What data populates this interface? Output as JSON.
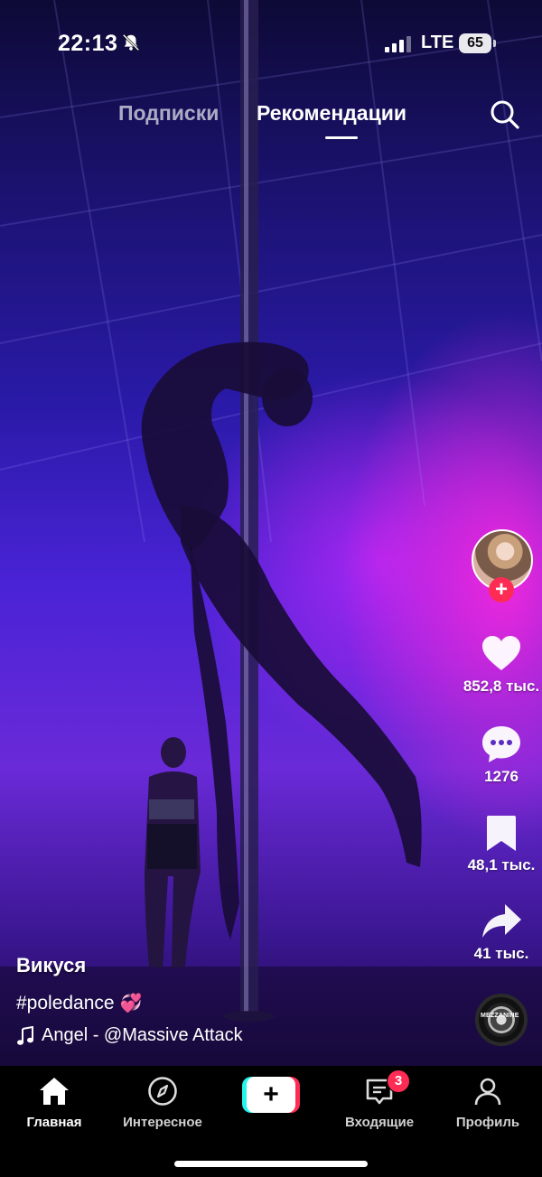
{
  "status_bar": {
    "time": "22:13",
    "network": "LTE",
    "battery": "65",
    "icons": [
      "bell-muted-icon",
      "signal-icon",
      "battery-icon"
    ]
  },
  "top_tabs": {
    "following": "Подписки",
    "for_you": "Рекомендации",
    "active": "for_you"
  },
  "video": {
    "author": "Викуся",
    "description": "#poledance",
    "description_emoji": "💞",
    "sound": "Angel - @Massive Attack",
    "disc_label": "MEZZANINE"
  },
  "actions": {
    "likes": "852,8 тыс.",
    "comments": "1276",
    "saves": "48,1 тыс.",
    "shares": "41 тыс."
  },
  "nav": {
    "home": "Главная",
    "discover": "Интересное",
    "create": "+",
    "inbox": "Входящие",
    "inbox_badge": "3",
    "profile": "Профиль"
  },
  "colors": {
    "accent": "#fe2c55",
    "cyan": "#25f4ee",
    "background": "#000000"
  }
}
